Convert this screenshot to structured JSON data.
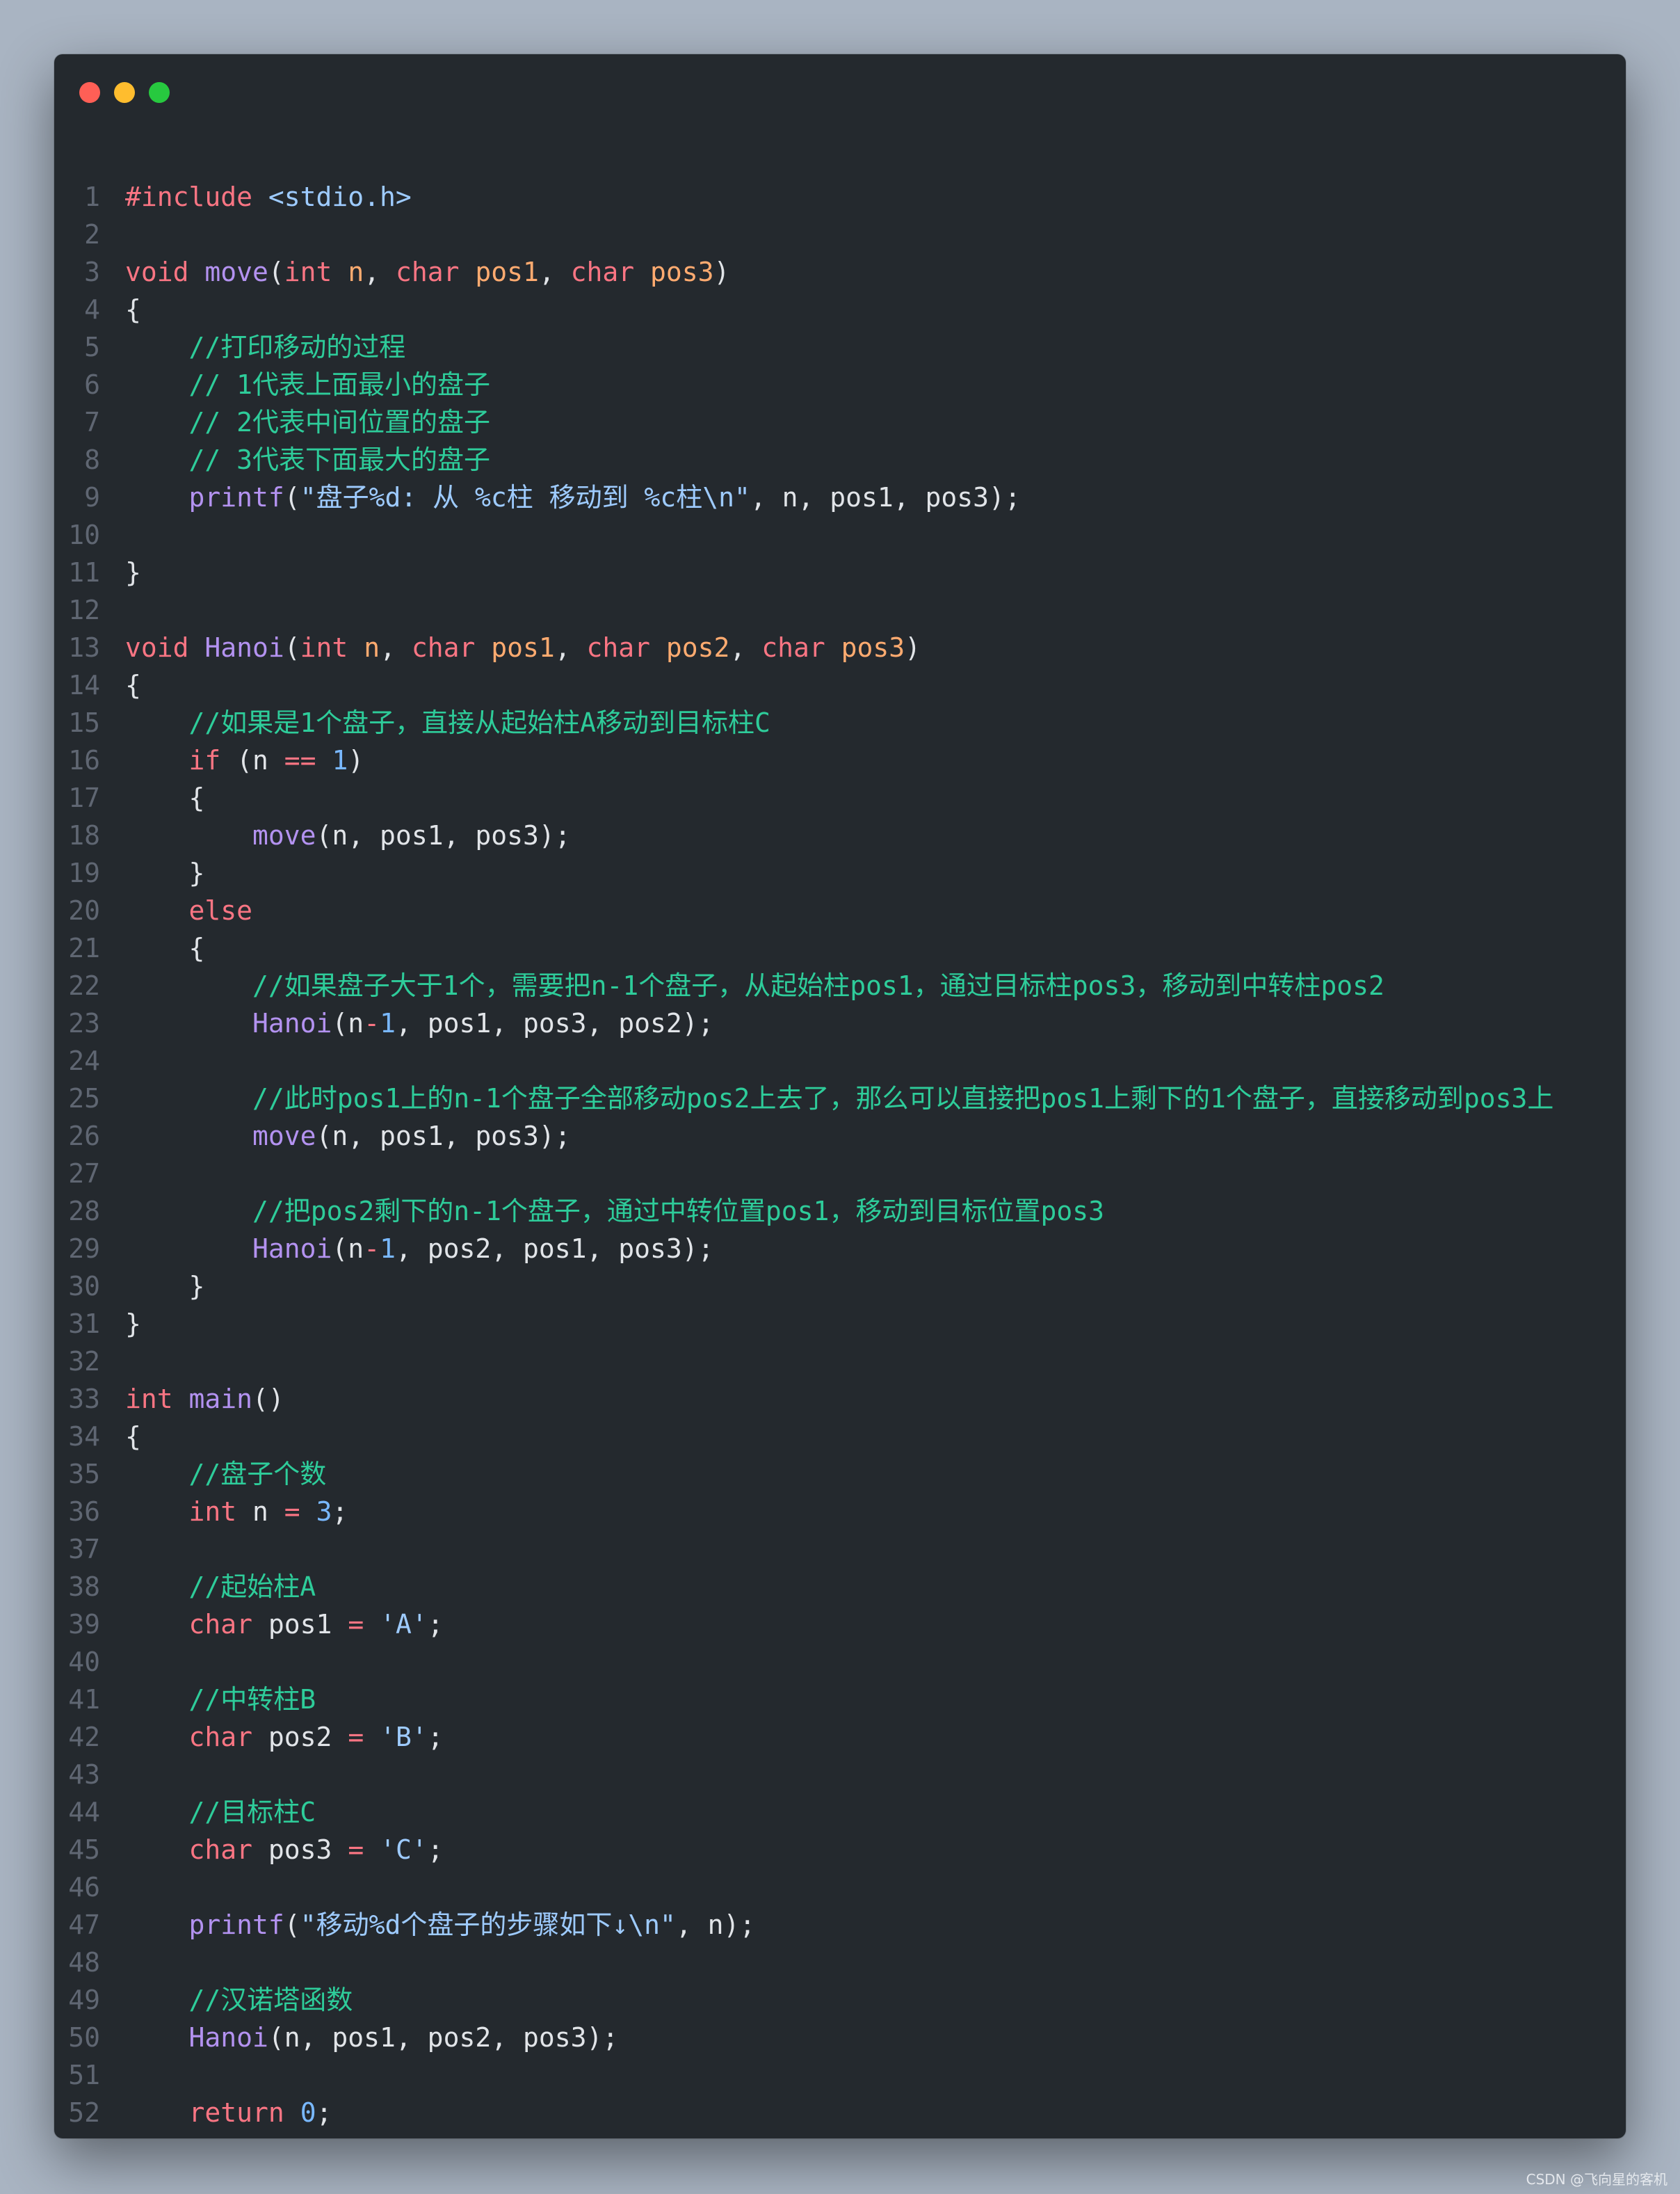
{
  "window": {
    "title_bar_buttons": [
      "close",
      "minimize",
      "maximize"
    ]
  },
  "colors": {
    "background": "#a9b4c2",
    "editor": "#24292e",
    "keyword": "#f97583",
    "function": "#b392f0",
    "parameter": "#ffab70",
    "string": "#9ecbff",
    "number": "#79b8ff",
    "comment": "#2ecc9a",
    "plain": "#e1e4e8",
    "line_number": "#5f6672"
  },
  "code": {
    "lines": [
      [
        {
          "t": "kw",
          "v": "#include "
        },
        {
          "t": "str",
          "v": "<stdio.h>"
        }
      ],
      [],
      [
        {
          "t": "kw",
          "v": "void "
        },
        {
          "t": "fn",
          "v": "move"
        },
        {
          "t": "p",
          "v": "("
        },
        {
          "t": "kw",
          "v": "int "
        },
        {
          "t": "var",
          "v": "n"
        },
        {
          "t": "p",
          "v": ", "
        },
        {
          "t": "kw",
          "v": "char "
        },
        {
          "t": "var",
          "v": "pos1"
        },
        {
          "t": "p",
          "v": ", "
        },
        {
          "t": "kw",
          "v": "char "
        },
        {
          "t": "var",
          "v": "pos3"
        },
        {
          "t": "p",
          "v": ")"
        }
      ],
      [
        {
          "t": "p",
          "v": "{"
        }
      ],
      [
        {
          "t": "cm",
          "v": "    //打印移动的过程"
        }
      ],
      [
        {
          "t": "cm",
          "v": "    // 1代表上面最小的盘子"
        }
      ],
      [
        {
          "t": "cm",
          "v": "    // 2代表中间位置的盘子"
        }
      ],
      [
        {
          "t": "cm",
          "v": "    // 3代表下面最大的盘子"
        }
      ],
      [
        {
          "t": "p",
          "v": "    "
        },
        {
          "t": "fn",
          "v": "printf"
        },
        {
          "t": "p",
          "v": "("
        },
        {
          "t": "str",
          "v": "\"盘子%d: 从 %c柱 移动到 %c柱\\n\""
        },
        {
          "t": "p",
          "v": ", n, pos1, pos3);"
        }
      ],
      [],
      [
        {
          "t": "p",
          "v": "}"
        }
      ],
      [],
      [
        {
          "t": "kw",
          "v": "void "
        },
        {
          "t": "fn",
          "v": "Hanoi"
        },
        {
          "t": "p",
          "v": "("
        },
        {
          "t": "kw",
          "v": "int "
        },
        {
          "t": "var",
          "v": "n"
        },
        {
          "t": "p",
          "v": ", "
        },
        {
          "t": "kw",
          "v": "char "
        },
        {
          "t": "var",
          "v": "pos1"
        },
        {
          "t": "p",
          "v": ", "
        },
        {
          "t": "kw",
          "v": "char "
        },
        {
          "t": "var",
          "v": "pos2"
        },
        {
          "t": "p",
          "v": ", "
        },
        {
          "t": "kw",
          "v": "char "
        },
        {
          "t": "var",
          "v": "pos3"
        },
        {
          "t": "p",
          "v": ")"
        }
      ],
      [
        {
          "t": "p",
          "v": "{"
        }
      ],
      [
        {
          "t": "cm",
          "v": "    //如果是1个盘子，直接从起始柱A移动到目标柱C"
        }
      ],
      [
        {
          "t": "p",
          "v": "    "
        },
        {
          "t": "kw",
          "v": "if"
        },
        {
          "t": "p",
          "v": " (n "
        },
        {
          "t": "op",
          "v": "=="
        },
        {
          "t": "p",
          "v": " "
        },
        {
          "t": "num",
          "v": "1"
        },
        {
          "t": "p",
          "v": ")"
        }
      ],
      [
        {
          "t": "p",
          "v": "    {"
        }
      ],
      [
        {
          "t": "p",
          "v": "        "
        },
        {
          "t": "fn",
          "v": "move"
        },
        {
          "t": "p",
          "v": "(n, pos1, pos3);"
        }
      ],
      [
        {
          "t": "p",
          "v": "    }"
        }
      ],
      [
        {
          "t": "p",
          "v": "    "
        },
        {
          "t": "kw",
          "v": "else"
        }
      ],
      [
        {
          "t": "p",
          "v": "    {"
        }
      ],
      [
        {
          "t": "cm",
          "v": "        //如果盘子大于1个，需要把n-1个盘子，从起始柱pos1，通过目标柱pos3，移动到中转柱pos2"
        }
      ],
      [
        {
          "t": "p",
          "v": "        "
        },
        {
          "t": "fn",
          "v": "Hanoi"
        },
        {
          "t": "p",
          "v": "(n"
        },
        {
          "t": "op",
          "v": "-"
        },
        {
          "t": "num",
          "v": "1"
        },
        {
          "t": "p",
          "v": ", pos1, pos3, pos2);"
        }
      ],
      [],
      [
        {
          "t": "cm",
          "v": "        //此时pos1上的n-1个盘子全部移动pos2上去了，那么可以直接把pos1上剩下的1个盘子，直接移动到pos3上"
        }
      ],
      [
        {
          "t": "p",
          "v": "        "
        },
        {
          "t": "fn",
          "v": "move"
        },
        {
          "t": "p",
          "v": "(n, pos1, pos3);"
        }
      ],
      [],
      [
        {
          "t": "cm",
          "v": "        //把pos2剩下的n-1个盘子，通过中转位置pos1，移动到目标位置pos3"
        }
      ],
      [
        {
          "t": "p",
          "v": "        "
        },
        {
          "t": "fn",
          "v": "Hanoi"
        },
        {
          "t": "p",
          "v": "(n"
        },
        {
          "t": "op",
          "v": "-"
        },
        {
          "t": "num",
          "v": "1"
        },
        {
          "t": "p",
          "v": ", pos2, pos1, pos3);"
        }
      ],
      [
        {
          "t": "p",
          "v": "    }"
        }
      ],
      [
        {
          "t": "p",
          "v": "}"
        }
      ],
      [],
      [
        {
          "t": "kw",
          "v": "int "
        },
        {
          "t": "fn",
          "v": "main"
        },
        {
          "t": "p",
          "v": "()"
        }
      ],
      [
        {
          "t": "p",
          "v": "{"
        }
      ],
      [
        {
          "t": "cm",
          "v": "    //盘子个数"
        }
      ],
      [
        {
          "t": "p",
          "v": "    "
        },
        {
          "t": "kw",
          "v": "int"
        },
        {
          "t": "p",
          "v": " n "
        },
        {
          "t": "op",
          "v": "="
        },
        {
          "t": "p",
          "v": " "
        },
        {
          "t": "num",
          "v": "3"
        },
        {
          "t": "p",
          "v": ";"
        }
      ],
      [],
      [
        {
          "t": "cm",
          "v": "    //起始柱A"
        }
      ],
      [
        {
          "t": "p",
          "v": "    "
        },
        {
          "t": "kw",
          "v": "char"
        },
        {
          "t": "p",
          "v": " pos1 "
        },
        {
          "t": "op",
          "v": "="
        },
        {
          "t": "p",
          "v": " "
        },
        {
          "t": "str",
          "v": "'A'"
        },
        {
          "t": "p",
          "v": ";"
        }
      ],
      [],
      [
        {
          "t": "cm",
          "v": "    //中转柱B"
        }
      ],
      [
        {
          "t": "p",
          "v": "    "
        },
        {
          "t": "kw",
          "v": "char"
        },
        {
          "t": "p",
          "v": " pos2 "
        },
        {
          "t": "op",
          "v": "="
        },
        {
          "t": "p",
          "v": " "
        },
        {
          "t": "str",
          "v": "'B'"
        },
        {
          "t": "p",
          "v": ";"
        }
      ],
      [],
      [
        {
          "t": "cm",
          "v": "    //目标柱C"
        }
      ],
      [
        {
          "t": "p",
          "v": "    "
        },
        {
          "t": "kw",
          "v": "char"
        },
        {
          "t": "p",
          "v": " pos3 "
        },
        {
          "t": "op",
          "v": "="
        },
        {
          "t": "p",
          "v": " "
        },
        {
          "t": "str",
          "v": "'C'"
        },
        {
          "t": "p",
          "v": ";"
        }
      ],
      [],
      [
        {
          "t": "p",
          "v": "    "
        },
        {
          "t": "fn",
          "v": "printf"
        },
        {
          "t": "p",
          "v": "("
        },
        {
          "t": "str",
          "v": "\"移动%d个盘子的步骤如下↓\\n\""
        },
        {
          "t": "p",
          "v": ", n);"
        }
      ],
      [],
      [
        {
          "t": "cm",
          "v": "    //汉诺塔函数"
        }
      ],
      [
        {
          "t": "p",
          "v": "    "
        },
        {
          "t": "fn",
          "v": "Hanoi"
        },
        {
          "t": "p",
          "v": "(n, pos1, pos2, pos3);"
        }
      ],
      [],
      [
        {
          "t": "p",
          "v": "    "
        },
        {
          "t": "kw",
          "v": "return"
        },
        {
          "t": "p",
          "v": " "
        },
        {
          "t": "num",
          "v": "0"
        },
        {
          "t": "p",
          "v": ";"
        }
      ],
      [
        {
          "t": "p",
          "v": "}"
        }
      ]
    ]
  },
  "watermark": "CSDN @飞向星的客机"
}
